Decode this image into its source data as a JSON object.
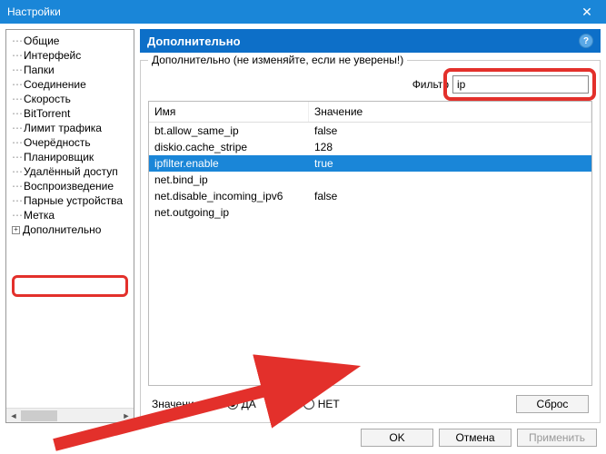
{
  "window": {
    "title": "Настройки"
  },
  "sidebar": {
    "items": [
      "Общие",
      "Интерфейс",
      "Папки",
      "Соединение",
      "Скорость",
      "BitTorrent",
      "Лимит трафика",
      "Очерёдность",
      "Планировщик",
      "Удалённый доступ",
      "Воспроизведение",
      "Парные устройства",
      "Метка",
      "Дополнительно"
    ]
  },
  "main": {
    "header": "Дополнительно",
    "group_label": "Дополнительно (не изменяйте, если не уверены!)",
    "filter_label": "Фильтр",
    "filter_value": "ip",
    "columns": {
      "name": "Имя",
      "value": "Значение"
    },
    "rows": [
      {
        "name": "bt.allow_same_ip",
        "value": "false",
        "selected": false
      },
      {
        "name": "diskio.cache_stripe",
        "value": "128",
        "selected": false
      },
      {
        "name": "ipfilter.enable",
        "value": "true",
        "selected": true
      },
      {
        "name": "net.bind_ip",
        "value": "",
        "selected": false
      },
      {
        "name": "net.disable_incoming_ipv6",
        "value": "false",
        "selected": false
      },
      {
        "name": "net.outgoing_ip",
        "value": "",
        "selected": false
      }
    ],
    "value_label": "Значение:",
    "radio_yes": "ДА",
    "radio_no": "НЕТ",
    "reset": "Сброс"
  },
  "footer": {
    "ok": "OK",
    "cancel": "Отмена",
    "apply": "Применить"
  }
}
